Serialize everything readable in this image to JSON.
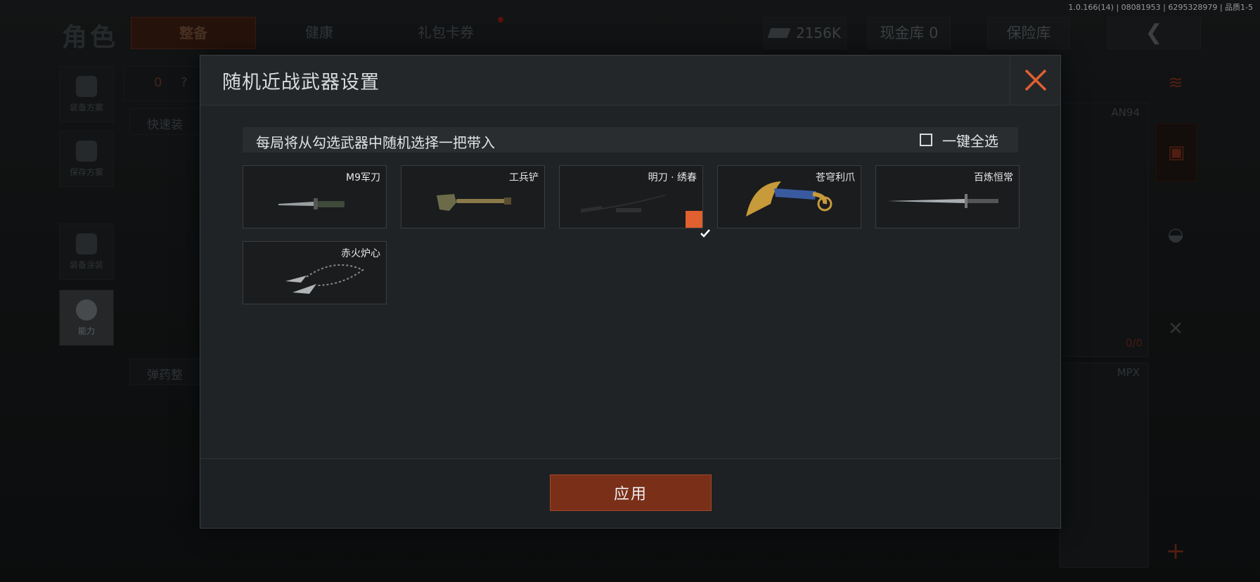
{
  "version": "1.0.166(14) | 08081953 | 6295328979 | 品质1-5",
  "header": {
    "title": "角色",
    "tabs": [
      {
        "label": "整备",
        "active": true
      },
      {
        "label": "健康",
        "active": false
      },
      {
        "label": "礼包卡券",
        "active": false
      }
    ],
    "cash": "2156K",
    "cash_vault": "现金库 0",
    "safe": "保险库"
  },
  "leftnav": [
    {
      "label": "装备方案"
    },
    {
      "label": "保存方案"
    },
    {
      "label": "装备涂装"
    },
    {
      "label": "能力"
    }
  ],
  "background_labels": {
    "armor_count": "0",
    "question": "?",
    "quick_equip": "快速装",
    "ammo": "弹药整",
    "weapon1": "AN94",
    "weapon2": "MPX",
    "weapon1_ammo": "0/0"
  },
  "modal": {
    "title": "随机近战武器设置",
    "info": "每局将从勾选武器中随机选择一把带入",
    "select_all": "一键全选",
    "apply": "应用",
    "weapons": [
      {
        "name": "M9军刀",
        "checked": false,
        "icon": "bayonet-icon"
      },
      {
        "name": "工兵铲",
        "checked": false,
        "icon": "shovel-icon"
      },
      {
        "name": "明刀 · 绣春",
        "checked": true,
        "icon": "saber-icon"
      },
      {
        "name": "苍穹利爪",
        "checked": false,
        "icon": "karambit-icon"
      },
      {
        "name": "百炼恒常",
        "checked": false,
        "icon": "sword-icon"
      },
      {
        "name": "赤火炉心",
        "checked": false,
        "icon": "chain-blade-icon"
      }
    ]
  },
  "colors": {
    "accent": "#e0602f",
    "apply_button": "#7a2f19",
    "modal_bg": "#202325"
  }
}
